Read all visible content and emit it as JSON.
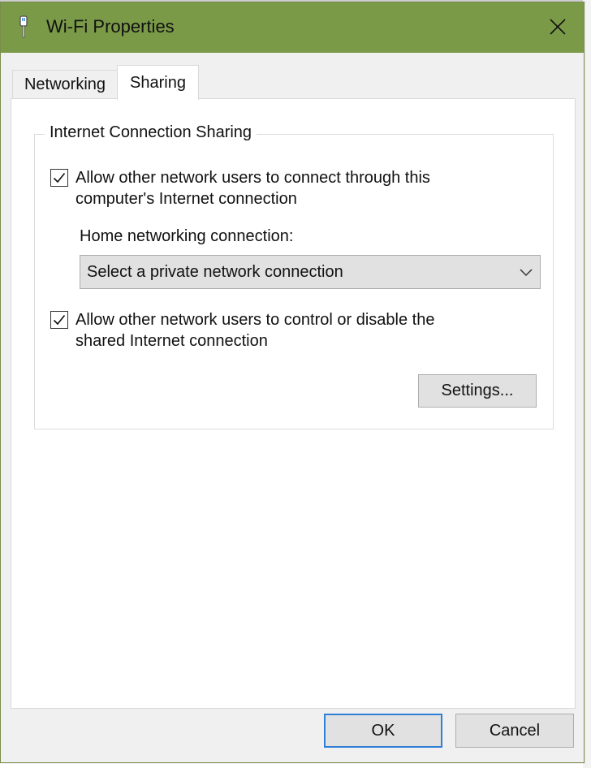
{
  "window": {
    "title": "Wi-Fi Properties",
    "titlebar_color": "#7a9a48",
    "icons": [
      "network-adapter-icon",
      "close-icon"
    ]
  },
  "tabs": [
    {
      "label": "Networking",
      "selected": false
    },
    {
      "label": "Sharing",
      "selected": true
    }
  ],
  "sharing": {
    "group_title": "Internet Connection Sharing",
    "allow_connect": {
      "checked": true,
      "label_line1": "Allow other network users to connect through this",
      "label_line2": "computer's Internet connection"
    },
    "home_connection": {
      "label": "Home networking connection:",
      "selected_value": "Select a private network connection"
    },
    "allow_control": {
      "checked": true,
      "label_line1": "Allow other network users to control or disable the",
      "label_line2": "shared Internet connection"
    },
    "settings_label": "Settings..."
  },
  "footer": {
    "ok_label": "OK",
    "cancel_label": "Cancel",
    "default_button_color": "#2f7fd6"
  }
}
